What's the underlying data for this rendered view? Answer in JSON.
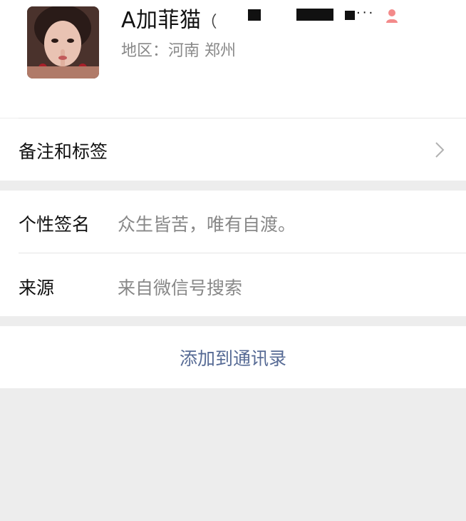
{
  "profile": {
    "name": "A加菲猫",
    "name_tail": "（",
    "dots": "·‧·",
    "region": "地区：河南 郑州",
    "gender_icon": "female-icon",
    "gender_color": "#fa5151"
  },
  "remarks": {
    "label": "备注和标签",
    "chevron_icon": "chevron-right-icon"
  },
  "info": {
    "signature_label": "个性签名",
    "signature_value": "众生皆苦，唯有自渡。",
    "source_label": "来源",
    "source_value": "来自微信号搜索"
  },
  "actions": {
    "add_contact": "添加到通讯录"
  },
  "colors": {
    "link": "#576b95",
    "background": "#ededed",
    "muted_text": "#888888"
  }
}
